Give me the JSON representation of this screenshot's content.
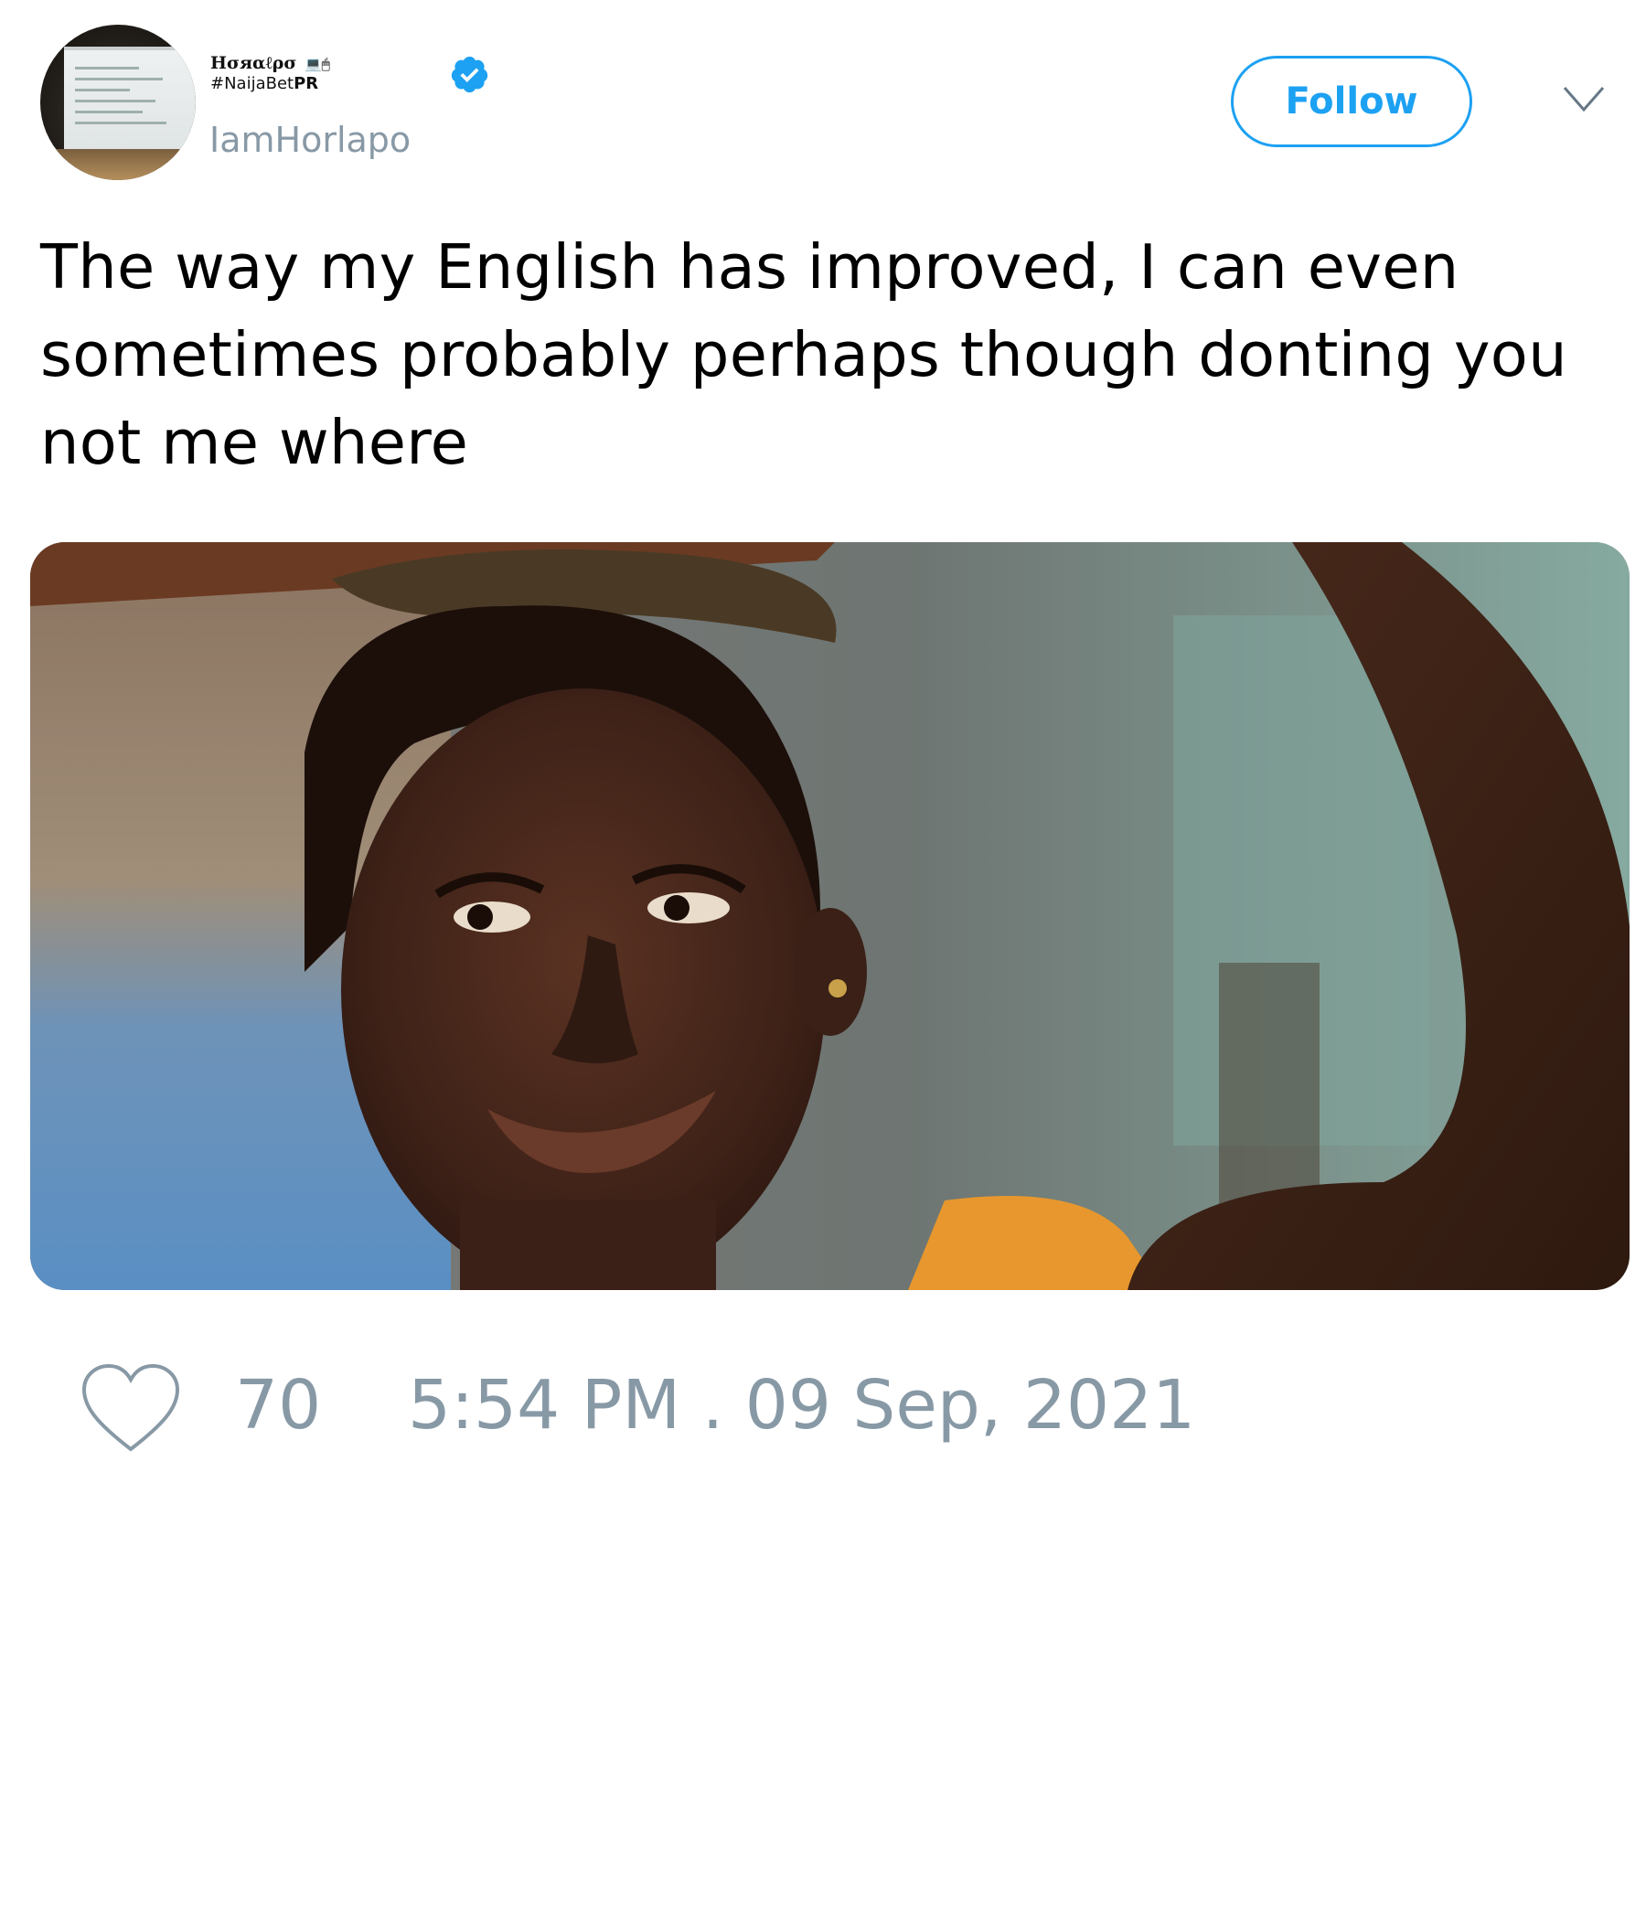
{
  "author": {
    "display_name": "Hσяαℓρσ",
    "name_glyphs": "💻🖱",
    "hashtag_prefix": "#NaijaBet",
    "hashtag_suffix": "PR",
    "handle": "IamHorlapo",
    "verified": true
  },
  "actions": {
    "follow_label": "Follow",
    "menu_icon": "chevron-down-icon"
  },
  "tweet": {
    "text": "The way my English has improved, I can even\nsometimes probably perhaps though donting you\nnot me where"
  },
  "footer": {
    "like_icon": "heart-icon",
    "like_count": "70",
    "timestamp": "5:54 PM . 09 Sep, 2021"
  },
  "colors": {
    "accent": "#1da1f2",
    "muted_text": "#8899a6",
    "text": "#000000",
    "background": "#ffffff"
  }
}
